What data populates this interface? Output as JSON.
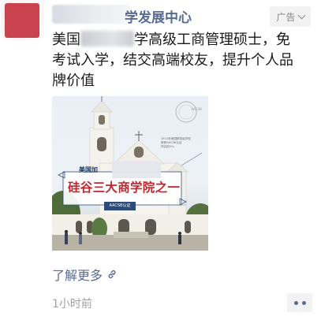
{
  "post": {
    "account_name_visible": "学发展中心",
    "ad_label": "广告",
    "body_line1_prefix": "美国",
    "body_line1_suffix": "学高级工商管理硕士，免",
    "body_line2": "考试入学，结交高端校友，提升个人品",
    "body_line3": "牌价值",
    "learn_more": "了解更多",
    "timestamp": "1小时前"
  },
  "ad_image": {
    "headline_small": "美国加",
    "headline_large": "硅谷三大商学院之一",
    "badge": "AACSB认证",
    "caption_line1": "1910年美国精英级学校",
    "caption_line2": "荣获AACSB认证",
    "caption_line3": "排名前5%",
    "seal_text": "AACSB",
    "colors": {
      "headline": "#c0282e",
      "sky": "#e9eff6",
      "building": "#f3f1ec"
    }
  },
  "icons": {
    "ad_menu": "chevron-down-icon",
    "link": "link-icon",
    "more": "more-icon"
  }
}
